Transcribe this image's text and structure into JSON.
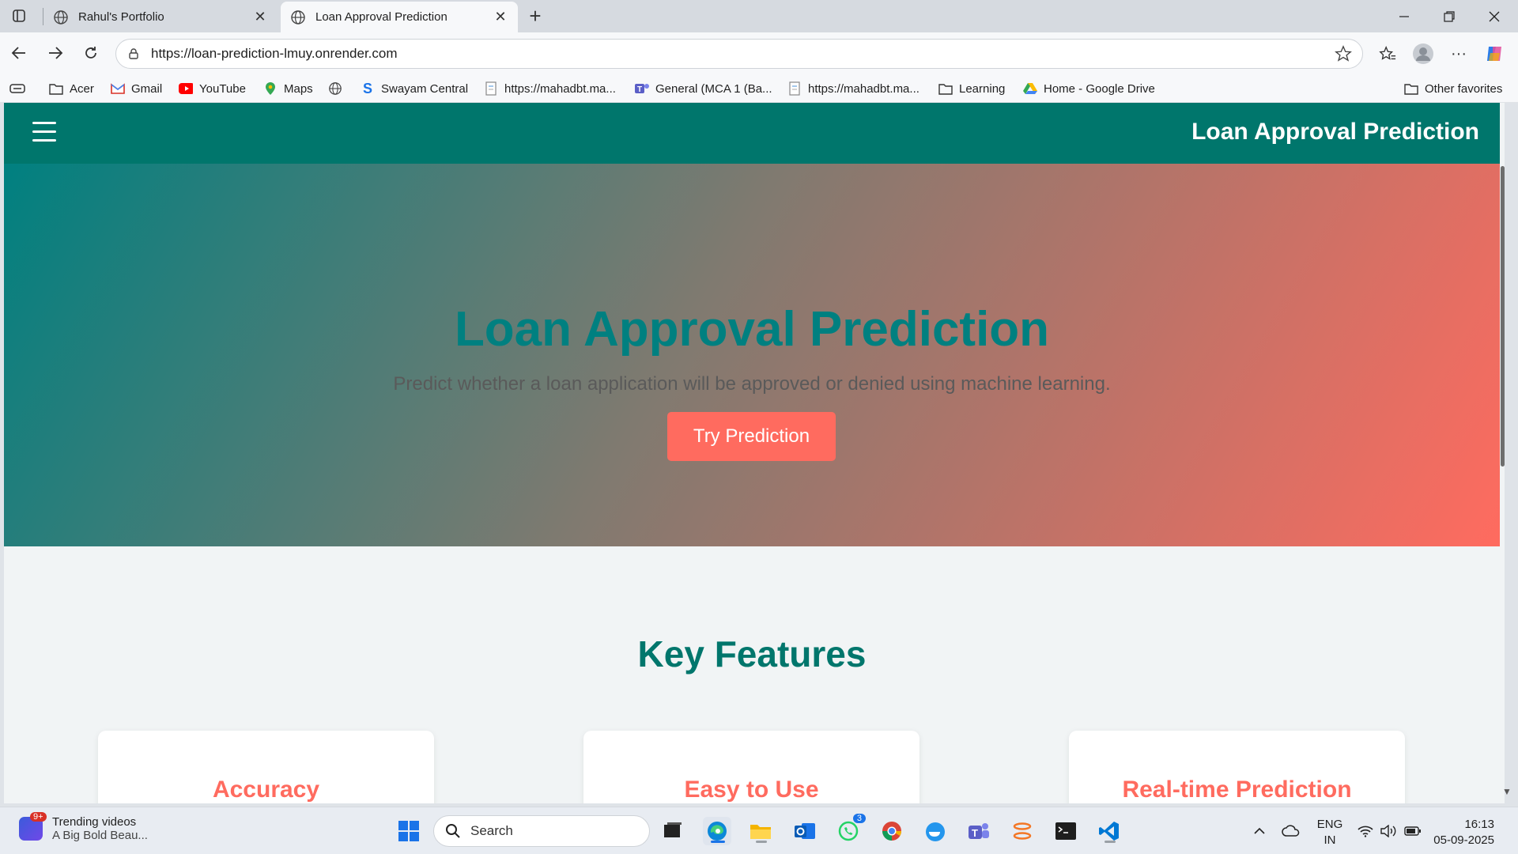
{
  "browser": {
    "tabs": [
      {
        "title": "Rahul's Portfolio",
        "active": false
      },
      {
        "title": "Loan Approval Prediction",
        "active": true
      }
    ],
    "url": "https://loan-prediction-lmuy.onrender.com",
    "favorites": [
      {
        "label": "Acer",
        "icon": "folder-icon"
      },
      {
        "label": "Gmail",
        "icon": "gmail-icon"
      },
      {
        "label": "YouTube",
        "icon": "youtube-icon"
      },
      {
        "label": "Maps",
        "icon": "maps-icon"
      },
      {
        "label": "",
        "icon": "globe-icon"
      },
      {
        "label": "Swayam Central",
        "icon": "swayam-icon"
      },
      {
        "label": "https://mahadbt.ma...",
        "icon": "page-icon"
      },
      {
        "label": "General (MCA 1 (Ba...",
        "icon": "teams-icon"
      },
      {
        "label": "https://mahadbt.ma...",
        "icon": "page-icon"
      },
      {
        "label": "Learning",
        "icon": "folder-icon"
      },
      {
        "label": "Home - Google Drive",
        "icon": "drive-icon"
      }
    ],
    "other_favorites": "Other favorites"
  },
  "app": {
    "nav_title": "Loan Approval Prediction",
    "hero": {
      "title": "Loan Approval Prediction",
      "subtitle": "Predict whether a loan application will be approved or denied using machine learning.",
      "cta": "Try Prediction"
    },
    "features": {
      "title": "Key Features",
      "cards": [
        "Accuracy",
        "Easy to Use",
        "Real-time Prediction"
      ]
    }
  },
  "taskbar": {
    "widget_title": "Trending videos",
    "widget_subtitle": "A Big Bold Beau...",
    "widget_badge": "9+",
    "search_label": "Search",
    "whatsapp_badge": "3",
    "lang_line1": "ENG",
    "lang_line2": "IN",
    "time": "16:13",
    "date": "05-09-2025"
  },
  "colors": {
    "teal": "#00766c",
    "coral": "#ff6b5f"
  }
}
